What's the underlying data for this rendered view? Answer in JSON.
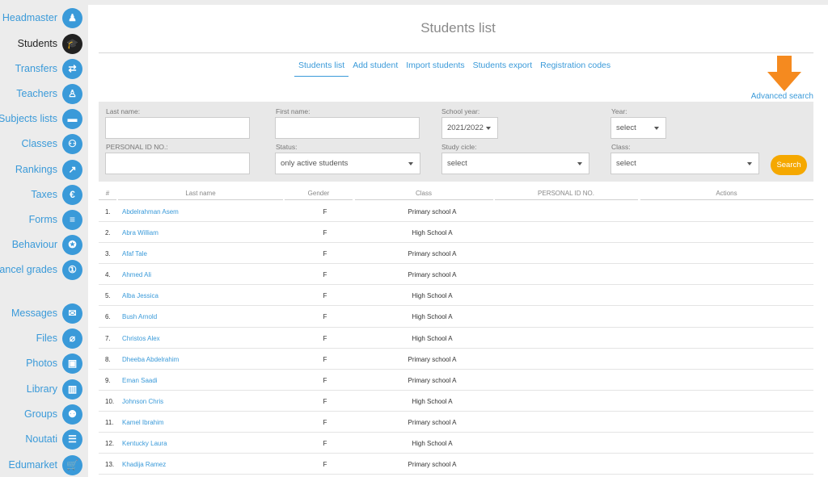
{
  "sidebar": {
    "items": [
      {
        "label": "Headmaster",
        "icon": "headmaster-icon",
        "glyph": "♟"
      },
      {
        "label": "Students",
        "icon": "graduation-cap-icon",
        "glyph": "🎓",
        "active": true
      },
      {
        "label": "Transfers",
        "icon": "transfer-arrows-icon",
        "glyph": "⇄"
      },
      {
        "label": "Teachers",
        "icon": "teacher-icon",
        "glyph": "♙"
      },
      {
        "label": "Subjects lists",
        "icon": "list-icon",
        "glyph": "▬"
      },
      {
        "label": "Classes",
        "icon": "group-icon",
        "glyph": "⚇"
      },
      {
        "label": "Rankings",
        "icon": "chart-trend-icon",
        "glyph": "↗"
      },
      {
        "label": "Taxes",
        "icon": "euro-icon",
        "glyph": "€"
      },
      {
        "label": "Forms",
        "icon": "checklist-icon",
        "glyph": "≡"
      },
      {
        "label": "Behaviour",
        "icon": "award-icon",
        "glyph": "✪"
      },
      {
        "label": "Cancel grades",
        "icon": "cancel-grades-icon",
        "glyph": "①"
      },
      {
        "label": "Messages",
        "icon": "envelope-icon",
        "glyph": "✉"
      },
      {
        "label": "Files",
        "icon": "paperclip-icon",
        "glyph": "⌀"
      },
      {
        "label": "Photos",
        "icon": "photos-icon",
        "glyph": "▣"
      },
      {
        "label": "Library",
        "icon": "books-icon",
        "glyph": "▥"
      },
      {
        "label": "Groups",
        "icon": "people-icon",
        "glyph": "⚉"
      },
      {
        "label": "Noutati",
        "icon": "news-icon",
        "glyph": "☰"
      },
      {
        "label": "Edumarket",
        "icon": "cart-icon",
        "glyph": "🛒"
      }
    ]
  },
  "page": {
    "title": "Students list",
    "tabs": [
      "Students list",
      "Add student",
      "Import students",
      "Students export",
      "Registration codes"
    ],
    "advanced_search": "Advanced search"
  },
  "filters": {
    "last_name_label": "Last name:",
    "first_name_label": "First name:",
    "school_year_label": "School year:",
    "school_year_value": "2021/2022",
    "year_label": "Year:",
    "year_value": "select",
    "personal_id_label": "PERSONAL ID NO.:",
    "status_label": "Status:",
    "status_value": "only active students",
    "study_cicle_label": "Study cicle:",
    "study_cicle_value": "select",
    "class_label": "Class:",
    "class_value": "select",
    "search_button": "Search"
  },
  "table": {
    "headers": {
      "num": "#",
      "last_name": "Last name",
      "gender": "Gender",
      "class": "Class",
      "personal_id": "PERSONAL ID NO.",
      "actions": "Actions"
    },
    "rows": [
      {
        "num": "1.",
        "name": "Abdelrahman Asem",
        "gender": "F",
        "class": "Primary school A"
      },
      {
        "num": "2.",
        "name": "Abra William",
        "gender": "F",
        "class": "High School A"
      },
      {
        "num": "3.",
        "name": "Afaf Tale",
        "gender": "F",
        "class": "Primary school A"
      },
      {
        "num": "4.",
        "name": "Ahmed Ali",
        "gender": "F",
        "class": "Primary school A"
      },
      {
        "num": "5.",
        "name": "Alba Jessica",
        "gender": "F",
        "class": "High School A"
      },
      {
        "num": "6.",
        "name": "Bush Arnold",
        "gender": "F",
        "class": "High School A"
      },
      {
        "num": "7.",
        "name": "Christos Alex",
        "gender": "F",
        "class": "High School A"
      },
      {
        "num": "8.",
        "name": "Dheeba Abdelrahim",
        "gender": "F",
        "class": "Primary school A"
      },
      {
        "num": "9.",
        "name": "Eman Saadi",
        "gender": "F",
        "class": "Primary school A"
      },
      {
        "num": "10.",
        "name": "Johnson Chris",
        "gender": "F",
        "class": "High School A"
      },
      {
        "num": "11.",
        "name": "Kamel Ibrahim",
        "gender": "F",
        "class": "Primary school A"
      },
      {
        "num": "12.",
        "name": "Kentucky Laura",
        "gender": "F",
        "class": "High School A"
      },
      {
        "num": "13.",
        "name": "Khadija Ramez",
        "gender": "F",
        "class": "Primary school A"
      }
    ]
  },
  "colors": {
    "accent": "#3a9ad9",
    "arrow": "#f58a1f",
    "search_button": "#f5a800"
  }
}
